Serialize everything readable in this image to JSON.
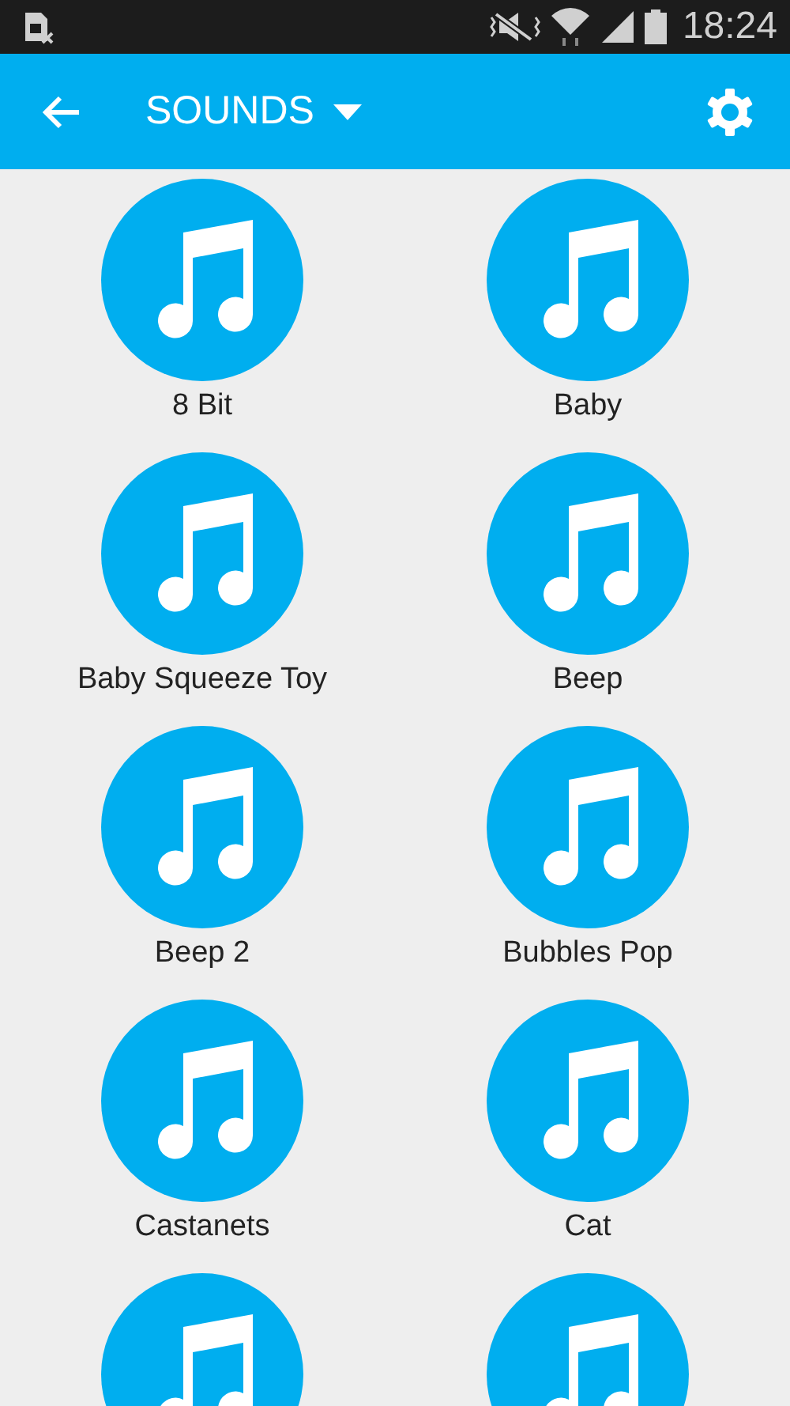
{
  "status_bar": {
    "time": "18:24"
  },
  "app_bar": {
    "title": "SOUNDS"
  },
  "sounds": [
    {
      "kind": "labeled",
      "label": "8 Bit"
    },
    {
      "kind": "labeled",
      "label": "Baby"
    },
    {
      "kind": "labeled",
      "label": "Baby Squeeze Toy"
    },
    {
      "kind": "labeled",
      "label": "Beep"
    },
    {
      "kind": "labeled",
      "label": "Beep 2"
    },
    {
      "kind": "labeled",
      "label": "Bubbles Pop"
    },
    {
      "kind": "labeled",
      "label": "Castanets"
    },
    {
      "kind": "labeled",
      "label": "Cat"
    },
    {
      "kind": "partial"
    },
    {
      "kind": "partial"
    }
  ]
}
